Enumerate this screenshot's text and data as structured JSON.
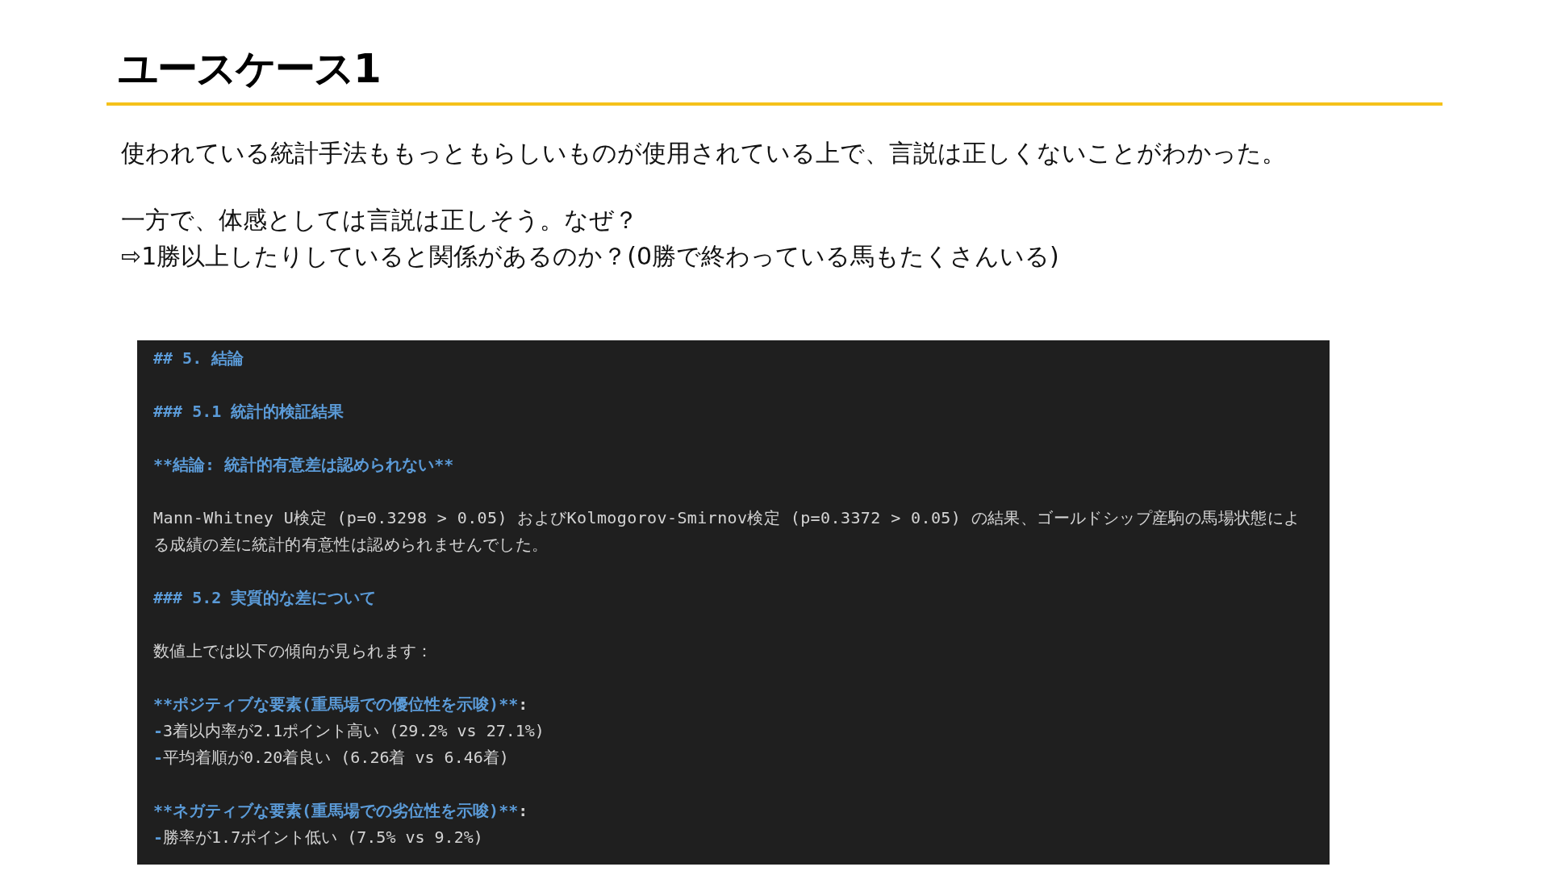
{
  "slide": {
    "title": "ユースケース1",
    "paragraphs": [
      {
        "lines": [
          "使われている統計手法ももっともらしいものが使用されている上で、言説は正しくないことがわかった。"
        ]
      },
      {
        "lines": [
          "一方で、体感としては言説は正しそう。なぜ？",
          "⇨1勝以上したりしていると関係があるのか？(0勝で終わっている馬もたくさんいる)"
        ]
      }
    ]
  },
  "editor": {
    "blocks": [
      {
        "lines": [
          {
            "kind": "heading",
            "text": "## 5. 結論"
          }
        ]
      },
      {
        "lines": [
          {
            "kind": "heading",
            "text": "### 5.1 統計的検証結果"
          }
        ]
      },
      {
        "lines": [
          {
            "kind": "bold",
            "text": "**結論: 統計的有意差は認められない**"
          }
        ]
      },
      {
        "lines": [
          {
            "kind": "text",
            "text": "Mann-Whitney U検定 (p=0.3298 > 0.05) およびKolmogorov-Smirnov検定 (p=0.3372 > 0.05) の結果、ゴールドシップ産駒の馬場状態による成績の差に統計的有意性は認められませんでした。"
          }
        ]
      },
      {
        "lines": [
          {
            "kind": "heading",
            "text": "### 5.2 実質的な差について"
          }
        ]
      },
      {
        "lines": [
          {
            "kind": "text",
            "text": "数値上では以下の傾向が見られます："
          }
        ]
      },
      {
        "lines": [
          {
            "kind": "bold",
            "text": "**ポジティブな要素(重馬場での優位性を示唆)**",
            "suffix": ":"
          },
          {
            "kind": "bullet",
            "marker": "-",
            "text": "3着以内率が2.1ポイント高い (29.2% vs 27.1%)"
          },
          {
            "kind": "bullet",
            "marker": "-",
            "text": "平均着順が0.20着良い (6.26着 vs 6.46着)"
          }
        ]
      },
      {
        "lines": [
          {
            "kind": "bold",
            "text": "**ネガティブな要素(重馬場での劣位性を示唆)**",
            "suffix": ":"
          },
          {
            "kind": "bullet",
            "marker": "-",
            "text": "勝率が1.7ポイント低い (7.5% vs 9.2%)"
          }
        ]
      }
    ]
  }
}
